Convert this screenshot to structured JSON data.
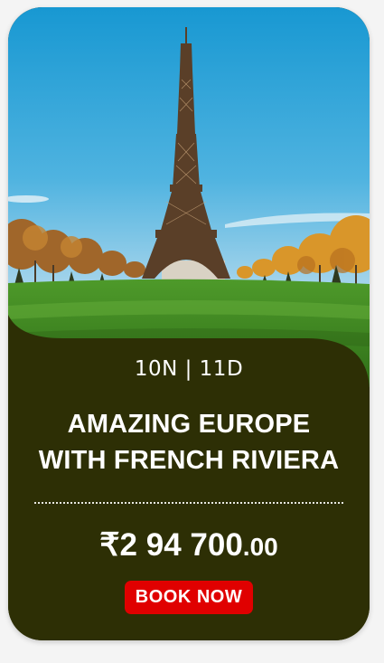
{
  "package": {
    "image": {
      "icon": "eiffel-tower-photo",
      "colors": {
        "sky_top": "#1a9fd6",
        "sky_bottom": "#cde6f2",
        "grass": "#3f8a22",
        "panel": "#2d2f05"
      }
    },
    "duration": "10N | 11D",
    "title_line1": "AMAZING EUROPE",
    "title_line2": "WITH FRENCH RIVIERA",
    "currency_symbol": "₹",
    "price_whole": "2 94 700",
    "price_decimal": ".00",
    "cta_label": "BOOK NOW",
    "cta_color": "#e00000"
  }
}
